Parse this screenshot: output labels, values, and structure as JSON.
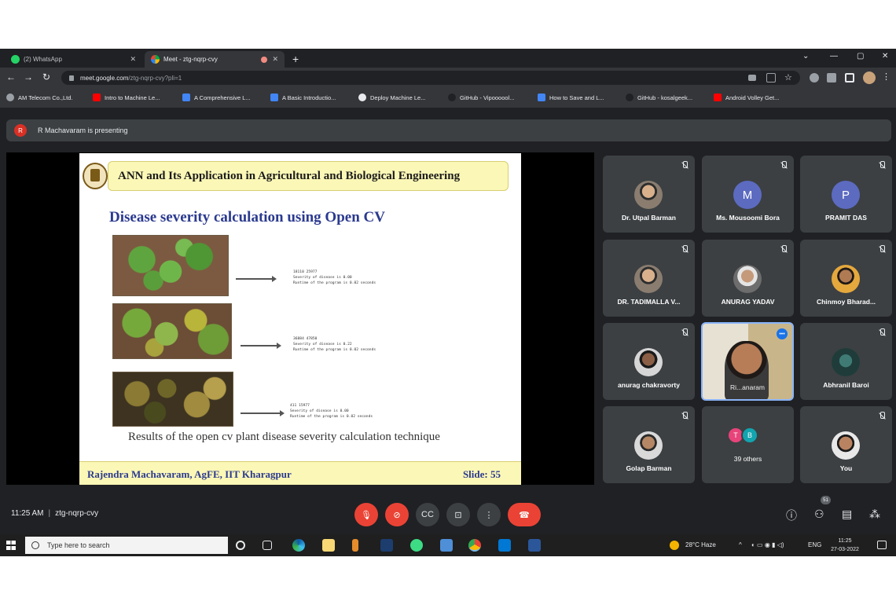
{
  "browser": {
    "tabs": [
      {
        "title": "(2) WhatsApp",
        "icon": "whatsapp-icon",
        "icon_color": "#25d366"
      },
      {
        "title": "Meet - ztg-nqrp-cvy",
        "icon": "meet-icon",
        "icon_color": "#00ac47"
      }
    ],
    "address": {
      "domain": "meet.google.com",
      "path": "/ztg-nqrp-cvy?pli=1"
    },
    "bookmarks": [
      {
        "label": "AM Telecom Co.,Ltd.",
        "icon_color": "#9aa0a6"
      },
      {
        "label": "Intro to Machine Le...",
        "icon_color": "#ff0000"
      },
      {
        "label": "A Comprehensive L...",
        "icon_color": "#4285f4"
      },
      {
        "label": "A Basic Introductio...",
        "icon_color": "#4285f4"
      },
      {
        "label": "Deploy Machine Le...",
        "icon_color": "#e8eaed"
      },
      {
        "label": "GitHub - Vipoooool...",
        "icon_color": "#202124"
      },
      {
        "label": "How to Save and L...",
        "icon_color": "#4285f4"
      },
      {
        "label": "GitHub - kosalgeek...",
        "icon_color": "#202124"
      },
      {
        "label": "Android Volley Get...",
        "icon_color": "#ff0000"
      }
    ]
  },
  "meet": {
    "presenter_initial": "R",
    "presenting_text": "R Machavaram is presenting",
    "slide": {
      "header": "ANN and Its Application in Agricultural and Biological Engineering",
      "title": "Disease severity calculation using Open CV",
      "outputs": [
        "18110 25977\nSeverity of disease is 0.00\nRuntime of the program is 0.02 seconds",
        "36884 47850\nSeverity of disease is 0.22\nRuntime of the program is 0.02 seconds",
        "411 15977\nSeverity of disease is 0.00\nRuntime of the program is 0.02 seconds"
      ],
      "caption": "Results of the open cv plant disease severity calculation technique",
      "footer_left": "Rajendra Machavaram, AgFE, IIT Kharagpur",
      "footer_right": "Slide: 55"
    },
    "participants": [
      {
        "name": "Dr. Utpal Barman",
        "initial": "",
        "color": ""
      },
      {
        "name": "Ms. Mousoomi Bora",
        "initial": "M",
        "color": "#5c6bc0"
      },
      {
        "name": "PRAMIT DAS",
        "initial": "P",
        "color": "#5c6bc0"
      },
      {
        "name": "DR. TADIMALLA V...",
        "initial": "",
        "color": ""
      },
      {
        "name": "ANURAG YADAV",
        "initial": "",
        "color": ""
      },
      {
        "name": "Chinmoy Bharad...",
        "initial": "",
        "color": ""
      },
      {
        "name": "anurag chakravorty",
        "initial": "",
        "color": ""
      },
      {
        "name": "Ri...anaram",
        "initial": "",
        "color": ""
      },
      {
        "name": "Abhranil Baroi",
        "initial": "",
        "color": ""
      },
      {
        "name": "Golap Barman",
        "initial": "",
        "color": ""
      },
      {
        "name": "39 others",
        "initial": "",
        "color": ""
      },
      {
        "name": "You",
        "initial": "",
        "color": ""
      }
    ],
    "others_initials": [
      {
        "letter": "T",
        "color": "#e8437a"
      },
      {
        "letter": "B",
        "color": "#12a4af"
      }
    ],
    "time": "11:25 AM",
    "meeting_code": "ztg-nqrp-cvy",
    "people_count": "51"
  },
  "taskbar": {
    "search_placeholder": "Type here to search",
    "weather": "28°C  Haze",
    "lang": "ENG",
    "time": "11:25",
    "date": "27-03-2022"
  },
  "colors": {
    "meet_dark": "#202124",
    "tile": "#3c4043",
    "hangup": "#ea4335",
    "slide_title_blue": "#2b3a8f",
    "slide_band_yellow": "#fbf7b6"
  }
}
